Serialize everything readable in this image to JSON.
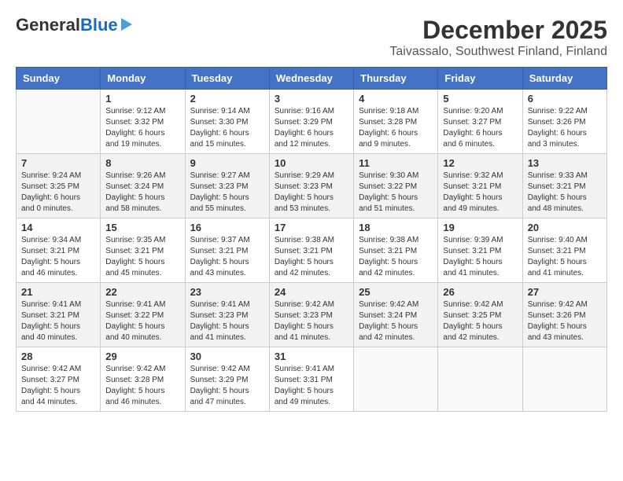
{
  "logo": {
    "line1": "General",
    "line2": "Blue"
  },
  "title": "December 2025",
  "subtitle": "Taivassalo, Southwest Finland, Finland",
  "days_header": [
    "Sunday",
    "Monday",
    "Tuesday",
    "Wednesday",
    "Thursday",
    "Friday",
    "Saturday"
  ],
  "weeks": [
    [
      {
        "day": "",
        "info": ""
      },
      {
        "day": "1",
        "info": "Sunrise: 9:12 AM\nSunset: 3:32 PM\nDaylight: 6 hours\nand 19 minutes."
      },
      {
        "day": "2",
        "info": "Sunrise: 9:14 AM\nSunset: 3:30 PM\nDaylight: 6 hours\nand 15 minutes."
      },
      {
        "day": "3",
        "info": "Sunrise: 9:16 AM\nSunset: 3:29 PM\nDaylight: 6 hours\nand 12 minutes."
      },
      {
        "day": "4",
        "info": "Sunrise: 9:18 AM\nSunset: 3:28 PM\nDaylight: 6 hours\nand 9 minutes."
      },
      {
        "day": "5",
        "info": "Sunrise: 9:20 AM\nSunset: 3:27 PM\nDaylight: 6 hours\nand 6 minutes."
      },
      {
        "day": "6",
        "info": "Sunrise: 9:22 AM\nSunset: 3:26 PM\nDaylight: 6 hours\nand 3 minutes."
      }
    ],
    [
      {
        "day": "7",
        "info": "Sunrise: 9:24 AM\nSunset: 3:25 PM\nDaylight: 6 hours\nand 0 minutes."
      },
      {
        "day": "8",
        "info": "Sunrise: 9:26 AM\nSunset: 3:24 PM\nDaylight: 5 hours\nand 58 minutes."
      },
      {
        "day": "9",
        "info": "Sunrise: 9:27 AM\nSunset: 3:23 PM\nDaylight: 5 hours\nand 55 minutes."
      },
      {
        "day": "10",
        "info": "Sunrise: 9:29 AM\nSunset: 3:23 PM\nDaylight: 5 hours\nand 53 minutes."
      },
      {
        "day": "11",
        "info": "Sunrise: 9:30 AM\nSunset: 3:22 PM\nDaylight: 5 hours\nand 51 minutes."
      },
      {
        "day": "12",
        "info": "Sunrise: 9:32 AM\nSunset: 3:21 PM\nDaylight: 5 hours\nand 49 minutes."
      },
      {
        "day": "13",
        "info": "Sunrise: 9:33 AM\nSunset: 3:21 PM\nDaylight: 5 hours\nand 48 minutes."
      }
    ],
    [
      {
        "day": "14",
        "info": "Sunrise: 9:34 AM\nSunset: 3:21 PM\nDaylight: 5 hours\nand 46 minutes."
      },
      {
        "day": "15",
        "info": "Sunrise: 9:35 AM\nSunset: 3:21 PM\nDaylight: 5 hours\nand 45 minutes."
      },
      {
        "day": "16",
        "info": "Sunrise: 9:37 AM\nSunset: 3:21 PM\nDaylight: 5 hours\nand 43 minutes."
      },
      {
        "day": "17",
        "info": "Sunrise: 9:38 AM\nSunset: 3:21 PM\nDaylight: 5 hours\nand 42 minutes."
      },
      {
        "day": "18",
        "info": "Sunrise: 9:38 AM\nSunset: 3:21 PM\nDaylight: 5 hours\nand 42 minutes."
      },
      {
        "day": "19",
        "info": "Sunrise: 9:39 AM\nSunset: 3:21 PM\nDaylight: 5 hours\nand 41 minutes."
      },
      {
        "day": "20",
        "info": "Sunrise: 9:40 AM\nSunset: 3:21 PM\nDaylight: 5 hours\nand 41 minutes."
      }
    ],
    [
      {
        "day": "21",
        "info": "Sunrise: 9:41 AM\nSunset: 3:21 PM\nDaylight: 5 hours\nand 40 minutes."
      },
      {
        "day": "22",
        "info": "Sunrise: 9:41 AM\nSunset: 3:22 PM\nDaylight: 5 hours\nand 40 minutes."
      },
      {
        "day": "23",
        "info": "Sunrise: 9:41 AM\nSunset: 3:23 PM\nDaylight: 5 hours\nand 41 minutes."
      },
      {
        "day": "24",
        "info": "Sunrise: 9:42 AM\nSunset: 3:23 PM\nDaylight: 5 hours\nand 41 minutes."
      },
      {
        "day": "25",
        "info": "Sunrise: 9:42 AM\nSunset: 3:24 PM\nDaylight: 5 hours\nand 42 minutes."
      },
      {
        "day": "26",
        "info": "Sunrise: 9:42 AM\nSunset: 3:25 PM\nDaylight: 5 hours\nand 42 minutes."
      },
      {
        "day": "27",
        "info": "Sunrise: 9:42 AM\nSunset: 3:26 PM\nDaylight: 5 hours\nand 43 minutes."
      }
    ],
    [
      {
        "day": "28",
        "info": "Sunrise: 9:42 AM\nSunset: 3:27 PM\nDaylight: 5 hours\nand 44 minutes."
      },
      {
        "day": "29",
        "info": "Sunrise: 9:42 AM\nSunset: 3:28 PM\nDaylight: 5 hours\nand 46 minutes."
      },
      {
        "day": "30",
        "info": "Sunrise: 9:42 AM\nSunset: 3:29 PM\nDaylight: 5 hours\nand 47 minutes."
      },
      {
        "day": "31",
        "info": "Sunrise: 9:41 AM\nSunset: 3:31 PM\nDaylight: 5 hours\nand 49 minutes."
      },
      {
        "day": "",
        "info": ""
      },
      {
        "day": "",
        "info": ""
      },
      {
        "day": "",
        "info": ""
      }
    ]
  ]
}
